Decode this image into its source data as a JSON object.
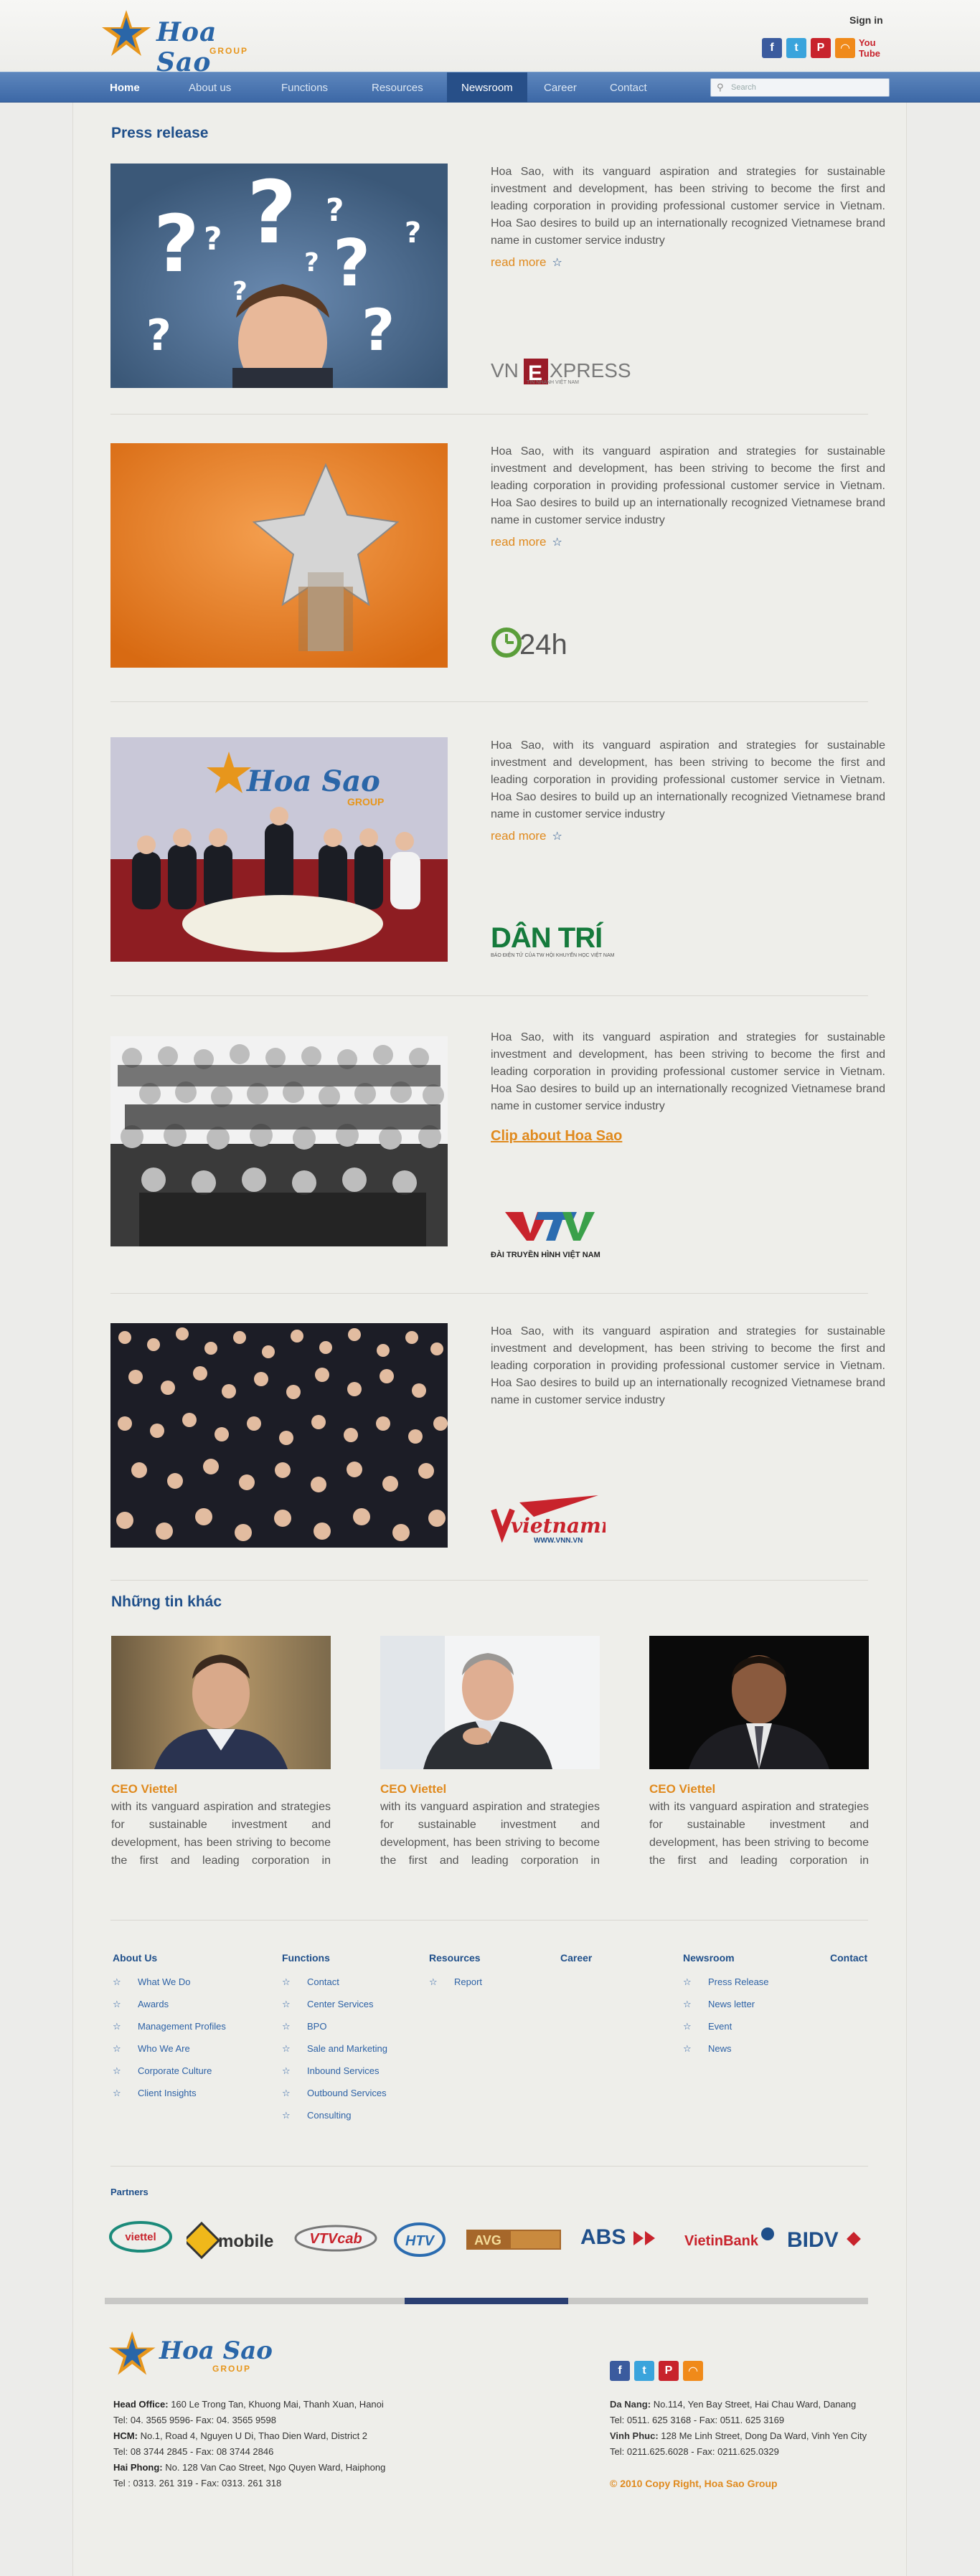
{
  "header": {
    "logo_text": "Hoa Sao",
    "logo_sub": "GROUP",
    "sign_in": "Sign in",
    "social": [
      "f",
      "t",
      "P",
      "rss",
      "You Tube"
    ]
  },
  "nav": {
    "items": [
      "Home",
      "About us",
      "Functions",
      "Resources",
      "Newsroom",
      "Career",
      "Contact"
    ],
    "search_placeholder": "Search"
  },
  "press": {
    "title": "Press release",
    "articles": [
      {
        "text": "Hoa Sao, with its vanguard aspiration and strategies for sustainable investment and development, has been striving to become the first and leading corporation in providing professional customer service in Vietnam. Hoa Sao desires to build up an internationally recognized Vietnamese brand name in customer service industry",
        "link": "read more",
        "source": "VNEXPRESS",
        "source_sub": "TIN NHANH VIỆT NAM"
      },
      {
        "text": "Hoa Sao, with its vanguard aspiration and strategies for sustainable investment and development, has been striving to become the first and leading corporation in providing professional customer service in Vietnam. Hoa Sao desires to build up an internationally recognized Vietnamese brand name in customer service industry",
        "link": "read more",
        "source": "24h"
      },
      {
        "text": "Hoa Sao, with its vanguard aspiration and strategies for sustainable investment and development, has been striving to become the first and leading corporation in providing professional customer service in Vietnam. Hoa Sao desires to build up an internationally recognized Vietnamese brand name in customer service industry",
        "link": "read more",
        "source": "DÂN TRÍ",
        "source_sub": "BÁO ĐIỆN TỬ CỦA TW HỘI KHUYẾN HỌC VIỆT NAM"
      },
      {
        "text": "Hoa Sao, with its vanguard aspiration and strategies for sustainable investment and development, has been striving to become the first and leading corporation in providing professional customer service in Vietnam. Hoa Sao desires to build up an internationally recognized Vietnamese brand name in customer service industry",
        "link": "Clip about Hoa Sao",
        "source": "VTV",
        "source_sub": "ĐÀI TRUYỀN HÌNH VIỆT NAM"
      },
      {
        "text": "Hoa Sao, with its vanguard aspiration and strategies for sustainable investment and development, has been striving to become the first and leading corporation in providing professional customer service in Vietnam. Hoa Sao desires to build up an internationally recognized Vietnamese brand name in customer service industry",
        "source": "vietnamnet",
        "source_sub": "WWW.VNN.VN"
      }
    ]
  },
  "other_news": {
    "title": "Những tin khác",
    "cards": [
      {
        "title": "CEO Viettel",
        "body": "with its vanguard aspiration and strategies for sustainable investment and development, has been striving to become the first and leading corporation in providing professional customer"
      },
      {
        "title": "CEO Viettel",
        "body": "with its vanguard aspiration and strategies for sustainable investment and development, has been striving to become the first and leading corporation in providing professional customer"
      },
      {
        "title": "CEO Viettel",
        "body": "with its vanguard aspiration and strategies for sustainable investment and development, has been striving to become the first and leading corporation in providing professional customer"
      }
    ]
  },
  "footer_nav": {
    "about": {
      "head": "About Us",
      "links": [
        "What We Do",
        "Awards",
        "Management Profiles",
        "Who We Are",
        "Corporate Culture",
        "Client Insights"
      ]
    },
    "functions": {
      "head": "Functions",
      "links": [
        "Contact",
        "Center Services",
        "BPO",
        "Sale and Marketing",
        "Inbound Services",
        "Outbound Services",
        "Consulting"
      ]
    },
    "resources": {
      "head": "Resources",
      "links": [
        "Report"
      ]
    },
    "career": {
      "head": "Career"
    },
    "newsroom": {
      "head": "Newsroom",
      "links": [
        "Press Release",
        "News letter",
        "Event",
        "News"
      ]
    },
    "contact": {
      "head": "Contact"
    }
  },
  "partners": {
    "title": "Partners",
    "items": [
      "viettel",
      "mobile",
      "VTVcab",
      "HTV",
      "AVG",
      "ABS",
      "VietinBank",
      "BIDV"
    ]
  },
  "footer": {
    "logo_text": "Hoa Sao",
    "logo_sub": "GROUP",
    "head_office_label": "Head Office:",
    "head_office": "160 Le Trong Tan,  Khuong Mai, Thanh Xuan, Hanoi",
    "head_office_tel": "Tel: 04. 3565 9596- Fax: 04. 3565 9598",
    "hcm_label": "HCM:",
    "hcm": "No.1, Road 4, Nguyen U Di, Thao Dien Ward, District 2",
    "hcm_tel": "Tel: 08 3744 2845 - Fax: 08 3744 2846",
    "hp_label": "Hai Phong:",
    "hp": "No. 128 Van Cao Street, Ngo Quyen Ward, Haiphong",
    "hp_tel": "Tel : 0313. 261 319 - Fax: 0313. 261 318",
    "dn_label": "Da Nang:",
    "dn": "No.114, Yen Bay Street, Hai Chau Ward, Danang",
    "dn_tel": "Tel: 0511. 625 3168 - Fax: 0511. 625 3169",
    "vp_label": "Vinh Phuc:",
    "vp": "128 Me Linh Street, Dong Da Ward, Vinh Yen City",
    "vp_tel": "Tel: 0211.625.6028 - Fax: 0211.625.0329",
    "copyright": "© 2010 Copy Right, Hoa Sao Group"
  },
  "colors": {
    "brand_blue": "#1f4f8a",
    "accent_orange": "#e08a1e",
    "nav_bg": "#3c68a6"
  }
}
